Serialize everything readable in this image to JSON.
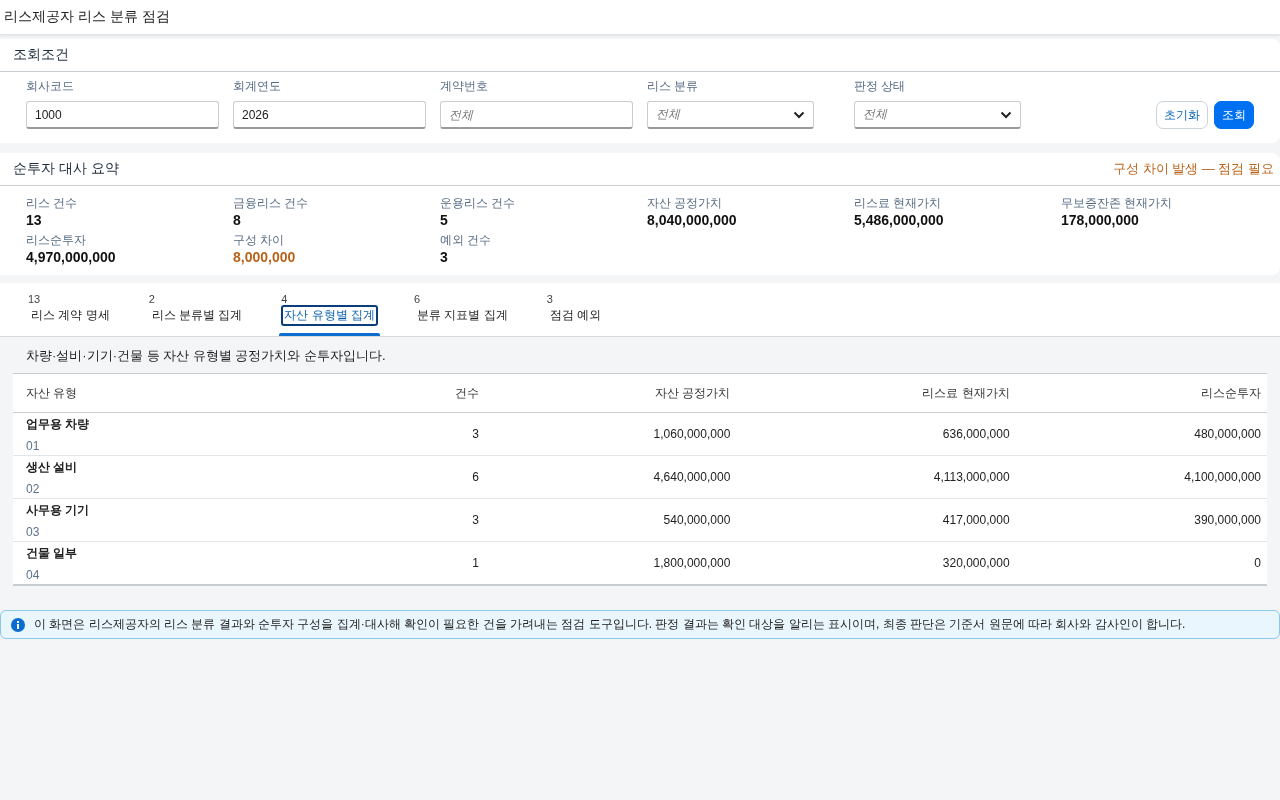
{
  "page_title": "리스제공자 리스 분류 점검",
  "filter_panel": {
    "title": "조회조건",
    "fields": [
      {
        "label": "회사코드",
        "kind": "text",
        "value": "1000"
      },
      {
        "label": "회계연도",
        "kind": "text",
        "value": "2026"
      },
      {
        "label": "계약번호",
        "kind": "text",
        "placeholder": "전체"
      },
      {
        "label": "리스 분류",
        "kind": "select",
        "placeholder": "전체"
      },
      {
        "label": "판정 상태",
        "kind": "select",
        "placeholder": "전체"
      }
    ],
    "buttons": [
      {
        "label": "초기화",
        "primary": false
      },
      {
        "label": "조회",
        "primary": true
      }
    ]
  },
  "summary": {
    "title": "순투자 대사 요약",
    "alert": "구성 차이 발생 — 점검 필요",
    "stats": [
      {
        "label": "리스 건수",
        "value": "13",
        "warning": false
      },
      {
        "label": "금융리스 건수",
        "value": "8",
        "warning": false
      },
      {
        "label": "운용리스 건수",
        "value": "5",
        "warning": false
      },
      {
        "label": "자산 공정가치",
        "value": "8,040,000,000",
        "warning": false
      },
      {
        "label": "리스료 현재가치",
        "value": "5,486,000,000",
        "warning": false
      },
      {
        "label": "무보증잔존 현재가치",
        "value": "178,000,000",
        "warning": false
      },
      {
        "label": "리스순투자",
        "value": "4,970,000,000",
        "warning": false
      },
      {
        "label": "구성 차이",
        "value": "8,000,000",
        "warning": true
      },
      {
        "label": "예외 건수",
        "value": "3",
        "warning": false
      }
    ]
  },
  "tabs": [
    {
      "count": "13",
      "label": "리스 계약 명세",
      "selected": false
    },
    {
      "count": "2",
      "label": "리스 분류별 집계",
      "selected": false
    },
    {
      "count": "4",
      "label": "자산 유형별 집계",
      "selected": true
    },
    {
      "count": "6",
      "label": "분류 지표별 집계",
      "selected": false
    },
    {
      "count": "3",
      "label": "점검 예외",
      "selected": false
    }
  ],
  "description": "차량·설비·기기·건물 등 자산 유형별 공정가치와 순투자입니다.",
  "table": {
    "columns": [
      "자산 유형",
      "건수",
      "자산 공정가치",
      "리스료 현재가치",
      "리스순투자"
    ],
    "rows": [
      {
        "asset_type": {
          "name": "업무용 차량",
          "code": "01"
        },
        "count": "3",
        "fair_value": "1,060,000,000",
        "lease_payments_pv": "636,000,000",
        "net_investment": "480,000,000"
      },
      {
        "asset_type": {
          "name": "생산 설비",
          "code": "02"
        },
        "count": "6",
        "fair_value": "4,640,000,000",
        "lease_payments_pv": "4,113,000,000",
        "net_investment": "4,100,000,000"
      },
      {
        "asset_type": {
          "name": "사무용 기기",
          "code": "03"
        },
        "count": "3",
        "fair_value": "540,000,000",
        "lease_payments_pv": "417,000,000",
        "net_investment": "390,000,000"
      },
      {
        "asset_type": {
          "name": "건물 일부",
          "code": "04"
        },
        "count": "1",
        "fair_value": "1,800,000,000",
        "lease_payments_pv": "320,000,000",
        "net_investment": "0"
      }
    ]
  },
  "notice": "이 화면은 리스제공자의 리스 분류 결과와 순투자 구성을 집계·대사해 확인이 필요한 건을 가려내는 점검 도구입니다. 판정 결과는 확인 대상을 알리는 표시이며, 최종 판단은 기준서 원문에 따라 회사와 감사인이 합니다."
}
